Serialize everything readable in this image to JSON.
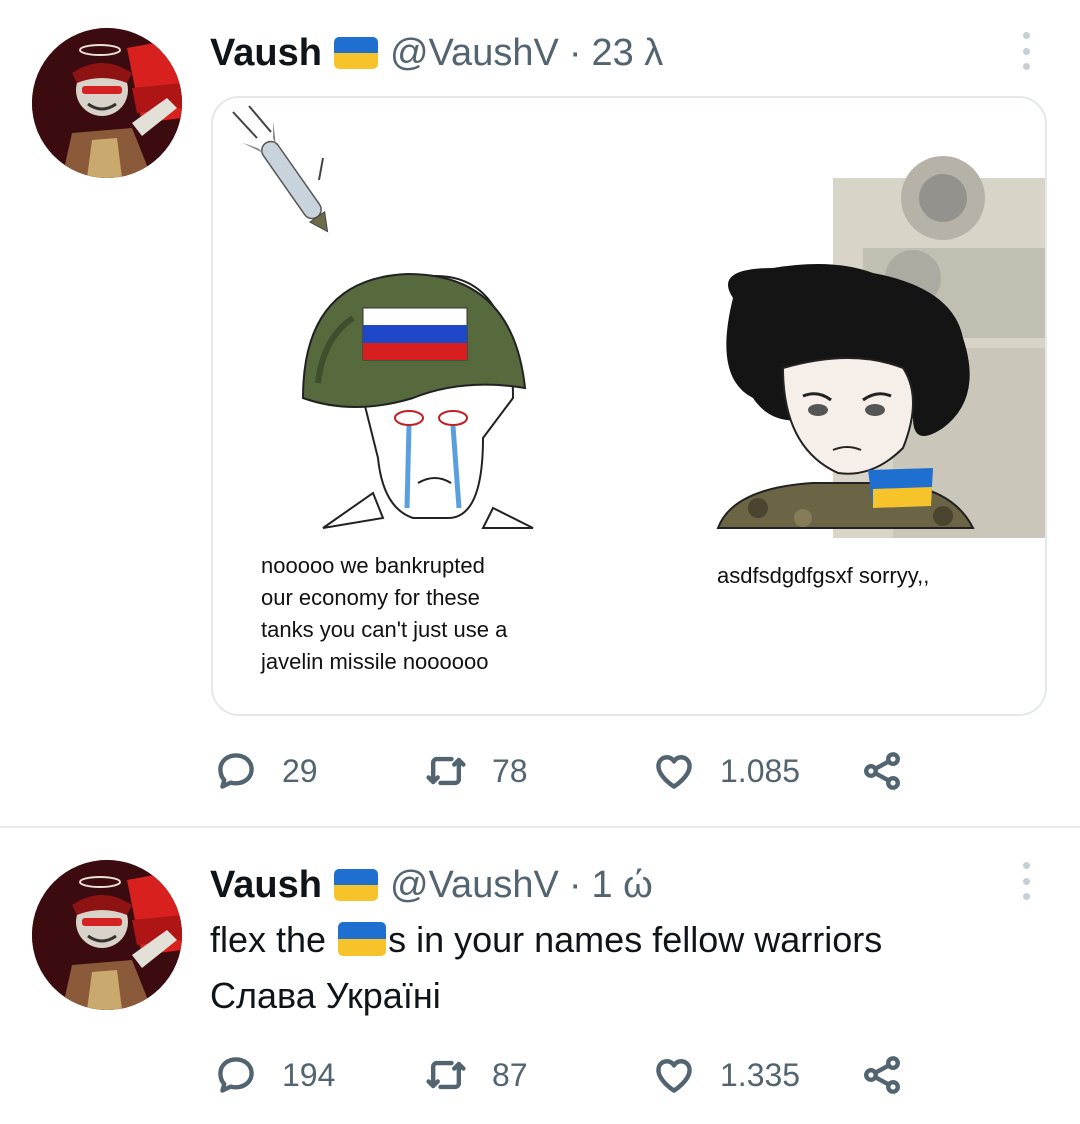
{
  "tweets": [
    {
      "author_name": "Vaush",
      "handle": "@VaushV",
      "separator": "·",
      "time": "23 λ",
      "media": {
        "caption_left": "nooooo we bankrupted\nour economy for these\ntanks you can't just use a\njavelin missile noooooo",
        "caption_right": "asdfsdgdfgsxf sorryy,,"
      },
      "stats": {
        "replies": "29",
        "retweets": "78",
        "likes": "1.085"
      }
    },
    {
      "author_name": "Vaush",
      "handle": "@VaushV",
      "separator": "·",
      "time": "1 ώ",
      "text_line1_before": "flex the ",
      "text_line1_after": "s in your names fellow warriors",
      "text_line2": "Слава Україні",
      "stats": {
        "replies": "194",
        "retweets": "87",
        "likes": "1.335"
      }
    }
  ],
  "icons": {
    "reply": "reply-icon",
    "retweet": "retweet-icon",
    "like": "heart-icon",
    "share": "share-icon",
    "more": "more-options-icon",
    "flag": "ukraine-flag-emoji"
  },
  "colors": {
    "text": "#0f1419",
    "secondary": "#536471",
    "divider": "#e7e9ea",
    "flag_blue": "#1f6fd1",
    "flag_yellow": "#f6c32b"
  }
}
